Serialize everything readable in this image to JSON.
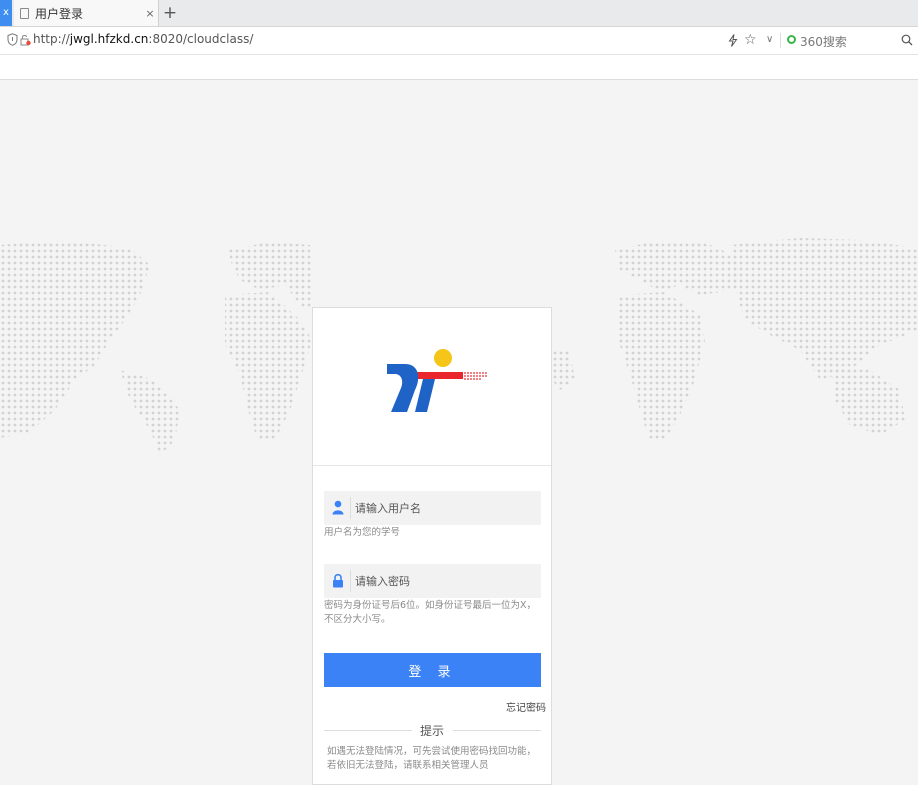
{
  "browser": {
    "prev_tab_close": "x",
    "tab_title": "用户登录",
    "tab_close": "×",
    "new_tab": "+",
    "url_scheme": "http://",
    "url_host": "jwgl.hfzkd.cn",
    "url_rest": ":8020/cloudclass/",
    "search_placeholder": "360搜索"
  },
  "login": {
    "username_placeholder": "请输入用户名",
    "username_hint": "用户名为您的学号",
    "password_placeholder": "请输入密码",
    "password_hint": "密码为身份证号后6位。如身份证号最后一位为X，不区分大小写。",
    "button_label": "登 录",
    "forgot_label": "忘记密码",
    "tips_title": "提示",
    "tips_text": "如遇无法登陆情况，可先尝试使用密码找回功能，若依旧无法登陆，请联系相关管理人员"
  },
  "colors": {
    "accent": "#3b82f6",
    "logo_blue": "#1f63c6",
    "logo_red": "#e8262b",
    "logo_yellow": "#f5c518",
    "map_dot": "#d2d2d2"
  }
}
